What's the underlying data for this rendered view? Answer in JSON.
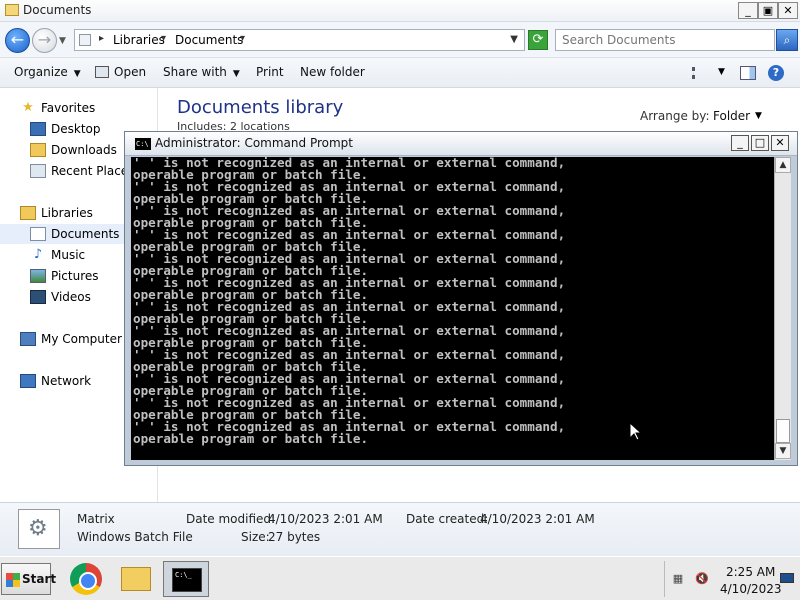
{
  "explorer": {
    "title": "Documents",
    "window_buttons": {
      "minimize": "_",
      "maximize": "▣",
      "close": "✕"
    },
    "breadcrumb": [
      "Libraries",
      "Documents"
    ],
    "search_placeholder": "Search Documents",
    "toolbar": {
      "organize": "Organize",
      "open": "Open",
      "share_with": "Share with",
      "print": "Print",
      "new_folder": "New folder"
    },
    "nav": {
      "favorites": "Favorites",
      "desktop": "Desktop",
      "downloads": "Downloads",
      "recent_places": "Recent Places",
      "libraries": "Libraries",
      "documents": "Documents",
      "music": "Music",
      "pictures": "Pictures",
      "videos": "Videos",
      "my_computer": "My Computer",
      "network": "Network"
    },
    "library": {
      "title": "Documents library",
      "subtitle": "Includes: 2 locations",
      "arrange_by_label": "Arrange by:",
      "arrange_by_value": "Folder"
    },
    "details": {
      "name": "Matrix",
      "type": "Windows Batch File",
      "date_modified_label": "Date modified:",
      "date_modified": "4/10/2023 2:01 AM",
      "date_created_label": "Date created:",
      "date_created": "4/10/2023 2:01 AM",
      "size_label": "Size:",
      "size": "27 bytes"
    }
  },
  "cmd": {
    "title": "Administrator:  Command Prompt",
    "icon_text": "C:\\",
    "buttons": {
      "minimize": "_",
      "maximize": "□",
      "close": "✕"
    },
    "lines": [
      "' ' is not recognized as an internal or external command,",
      "operable program or batch file.",
      "' ' is not recognized as an internal or external command,",
      "operable program or batch file.",
      "' ' is not recognized as an internal or external command,",
      "operable program or batch file.",
      "' ' is not recognized as an internal or external command,",
      "operable program or batch file.",
      "' ' is not recognized as an internal or external command,",
      "operable program or batch file.",
      "' ' is not recognized as an internal or external command,",
      "operable program or batch file.",
      "' ' is not recognized as an internal or external command,",
      "operable program or batch file.",
      "' ' is not recognized as an internal or external command,",
      "operable program or batch file.",
      "' ' is not recognized as an internal or external command,",
      "operable program or batch file.",
      "' ' is not recognized as an internal or external command,",
      "operable program or batch file.",
      "' ' is not recognized as an internal or external command,",
      "operable program or batch file.",
      "' ' is not recognized as an internal or external command,",
      "operable program or batch file."
    ]
  },
  "taskbar": {
    "start_label": "Start",
    "cmd_icon_text": "C:\\_",
    "clock_time": "2:25 AM",
    "clock_date": "4/10/2023"
  },
  "icons": {
    "back": "back-arrow-icon",
    "forward": "forward-arrow-icon",
    "refresh": "refresh-icon",
    "search": "search-icon",
    "help": "help-icon"
  }
}
